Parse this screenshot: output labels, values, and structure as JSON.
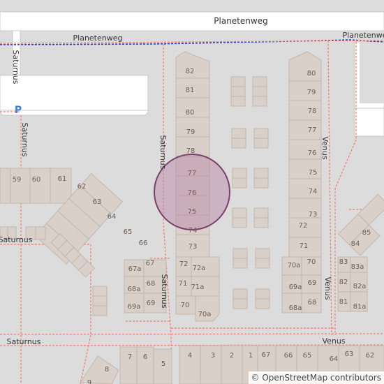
{
  "map": {
    "attribution": "© OpenStreetMap contributors",
    "parking_symbol": "P",
    "colors": {
      "background": "#dcdcdc",
      "road": "#ffffff",
      "road_casing": "#bdbdbd",
      "building": "#d9d0c9",
      "building_outline": "#c4b6ab",
      "footway": "#f07b71",
      "boundary": "#2a2fd8",
      "parking": "#3f7fd1",
      "marker_fill": "#b98aa9",
      "marker_stroke": "#7a3f6c",
      "label": "#333333",
      "house_number": "#6e5d52"
    },
    "streets": [
      "Planetenweg",
      "Planetenweg",
      "Saturnus",
      "Saturnus",
      "Saturnus",
      "Saturnus",
      "Saturnus",
      "Venus",
      "Venus",
      "Venus",
      "Saturnus"
    ],
    "house_numbers": [
      "82",
      "81",
      "80",
      "79",
      "78",
      "77",
      "76",
      "75",
      "74",
      "73",
      "72",
      "72a",
      "71",
      "71a",
      "70",
      "70a",
      "80",
      "79",
      "78",
      "77",
      "76",
      "75",
      "74",
      "73",
      "72",
      "71",
      "70a",
      "70",
      "69a",
      "69",
      "68a",
      "68",
      "59",
      "60",
      "61",
      "62",
      "63",
      "64",
      "65",
      "66",
      "67a",
      "67",
      "68a",
      "68",
      "69a",
      "69",
      "85",
      "84",
      "83",
      "83a",
      "82",
      "82a",
      "81",
      "81a",
      "8",
      "7",
      "6",
      "5",
      "4",
      "3",
      "2",
      "1",
      "67",
      "66",
      "65",
      "64",
      "63",
      "62"
    ]
  }
}
